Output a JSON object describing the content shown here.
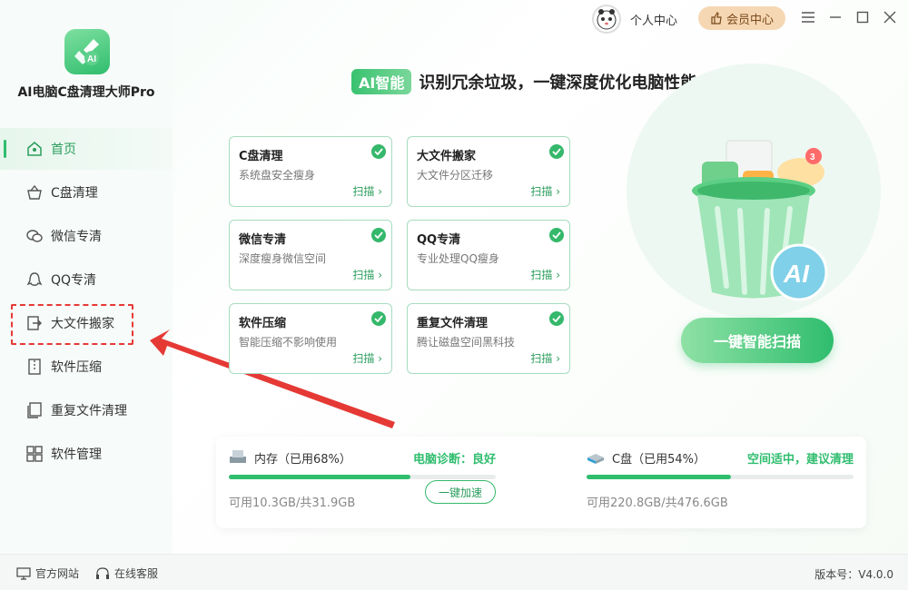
{
  "app": {
    "name": "AI电脑C盘清理大师Pro"
  },
  "nav": {
    "items": [
      {
        "label": "首页",
        "icon": "home-icon"
      },
      {
        "label": "C盘清理",
        "icon": "basket-icon"
      },
      {
        "label": "微信专清",
        "icon": "wechat-icon"
      },
      {
        "label": "QQ专清",
        "icon": "qq-icon"
      },
      {
        "label": "大文件搬家",
        "icon": "move-file-icon"
      },
      {
        "label": "软件压缩",
        "icon": "zip-icon"
      },
      {
        "label": "重复文件清理",
        "icon": "duplicate-icon"
      },
      {
        "label": "软件管理",
        "icon": "apps-icon"
      }
    ]
  },
  "topbar": {
    "user_label": "个人中心",
    "vip_label": "会员中心"
  },
  "headline": {
    "tag": "AI智能",
    "text": "识别冗余垃圾，一键深度优化电脑性能"
  },
  "cards": [
    {
      "title": "C盘清理",
      "desc": "系统盘安全瘦身",
      "action": "扫描 ›"
    },
    {
      "title": "大文件搬家",
      "desc": "大文件分区迁移",
      "action": "扫描 ›"
    },
    {
      "title": "微信专清",
      "desc": "深度瘦身微信空间",
      "action": "扫描 ›"
    },
    {
      "title": "QQ专清",
      "desc": "专业处理QQ瘦身",
      "action": "扫描 ›"
    },
    {
      "title": "软件压缩",
      "desc": "智能压缩不影响使用",
      "action": "扫描 ›"
    },
    {
      "title": "重复文件清理",
      "desc": "腾让磁盘空间黑科技",
      "action": "扫描 ›"
    }
  ],
  "scan_button": "一键智能扫描",
  "ai_badge": "AI",
  "notif_count": "3",
  "memory": {
    "label": "内存（已用68%）",
    "percent": 68,
    "status": "电脑诊断：良好",
    "free": "可用10.3GB/共31.9GB",
    "action": "一键加速"
  },
  "disk": {
    "label": "C盘（已用54%）",
    "percent": 54,
    "status": "空间适中，建议清理",
    "free": "可用220.8GB/共476.6GB"
  },
  "footer": {
    "website": "官方网站",
    "support": "在线客服",
    "version": "版本号：V4.0.0"
  },
  "colors": {
    "accent": "#2fbd6e",
    "highlight": "#e53935"
  }
}
